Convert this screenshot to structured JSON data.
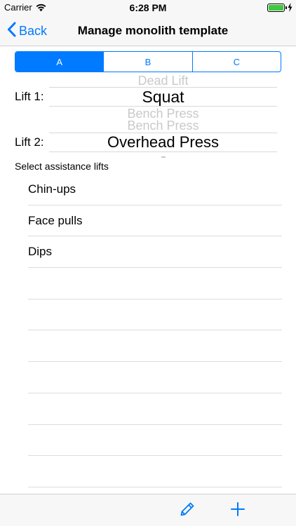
{
  "status_bar": {
    "carrier": "Carrier",
    "time": "6:28 PM",
    "battery_level": 1.0
  },
  "nav": {
    "back_label": "Back",
    "title": "Manage monolith template"
  },
  "segments": [
    "A",
    "B",
    "C"
  ],
  "selected_segment": "A",
  "lift1": {
    "label": "Lift 1:",
    "picker": {
      "above": "Dead Lift",
      "selected": "Squat",
      "below": "Bench Press"
    }
  },
  "lift2": {
    "label": "Lift 2:",
    "picker": {
      "above": "Bench Press",
      "selected": "Overhead Press",
      "below": ""
    }
  },
  "assistance": {
    "header": "Select assistance lifts",
    "items": [
      "Chin-ups",
      "Face pulls",
      "Dips",
      "",
      "",
      "",
      "",
      "",
      "",
      "",
      ""
    ]
  },
  "toolbar": {
    "icons": [
      "pencil-icon",
      "plus-icon"
    ]
  },
  "colors": {
    "accent": "#007aff",
    "battery": "#3fc93f",
    "bars": "#f7f7f7"
  }
}
